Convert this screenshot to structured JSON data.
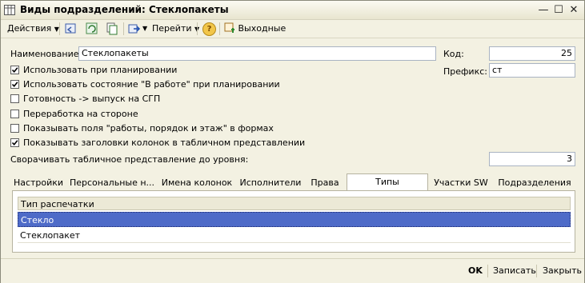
{
  "window": {
    "title": "Виды подразделений: Стеклопакеты",
    "minimize_glyph": "—",
    "maximize_glyph": "☐",
    "close_glyph": "✕"
  },
  "toolbar": {
    "actions_label": "Действия",
    "goto_label": "Перейти",
    "weekends_label": "Выходные",
    "help_glyph": "?"
  },
  "form": {
    "name_label": "Наименование:",
    "name_value": "Стеклопакеты",
    "code_label": "Код:",
    "code_value": "25",
    "prefix_label": "Префикс:",
    "prefix_value": "ст",
    "collapse_label": "Сворачивать табличное представление до уровня:",
    "collapse_value": "3",
    "checkboxes": [
      {
        "label": "Использовать при планировании",
        "checked": true
      },
      {
        "label": "Использовать состояние \"В работе\" при планировании",
        "checked": true
      },
      {
        "label": "Готовность -> выпуск на СГП",
        "checked": false
      },
      {
        "label": "Переработка на стороне",
        "checked": false
      },
      {
        "label": "Показывать поля \"работы, порядок и этаж\" в формах",
        "checked": false
      },
      {
        "label": "Показывать заголовки колонок в табличном представлении",
        "checked": true
      }
    ]
  },
  "tabs": [
    {
      "label": "Настройки"
    },
    {
      "label": "Персональные н..."
    },
    {
      "label": "Имена колонок"
    },
    {
      "label": "Исполнители"
    },
    {
      "label": "Права"
    },
    {
      "label": "Типы распечатки"
    },
    {
      "label": "Участки SW"
    },
    {
      "label": "Подразделения"
    }
  ],
  "active_tab": "Типы распечатки",
  "table": {
    "column_header": "Тип распечатки",
    "rows": [
      "Стекло",
      "Стеклопакет"
    ],
    "selected_row": "Стекло"
  },
  "footer": {
    "ok_label": "OK",
    "save_label": "Записать",
    "close_label": "Закрыть"
  }
}
